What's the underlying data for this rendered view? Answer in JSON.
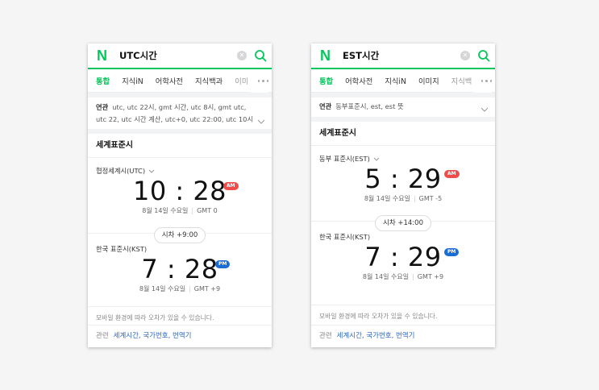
{
  "left": {
    "query": "UTC시간",
    "tabs": [
      "통합",
      "지식iN",
      "어학사전",
      "지식백과",
      "이미"
    ],
    "related_label": "연관",
    "related_text": "utc, utc 22시, gmt 시간, utc 8시, gmt utc, utc 22, utc 시간 계산, utc+0, utc 22:00, utc 10시",
    "section_title": "세계표준시",
    "zone1": "협정세계시(UTC)",
    "time1": "10 : 28",
    "ampm1": "AM",
    "date1": "8월 14일 수요일",
    "gmt1": "GMT 0",
    "diff": "시차 +9:00",
    "zone2": "한국 표준시(KST)",
    "time2": "7 : 28",
    "ampm2": "PM",
    "date2": "8월 14일 수요일",
    "gmt2": "GMT +9",
    "notice": "모바일 환경에 따라 오차가 있을 수 있습니다.",
    "footer_label": "관련",
    "footer_links": "세계시간, 국가번호, 번역기"
  },
  "right": {
    "query": "EST시간",
    "tabs": [
      "통합",
      "어학사전",
      "지식iN",
      "이미지",
      "지식백"
    ],
    "related_label": "연관",
    "related_text": "동부표준시, est, est 뜻",
    "section_title": "세계표준시",
    "zone1": "동부 표준시(EST)",
    "time1": "5 : 29",
    "ampm1": "AM",
    "date1": "8월 14일 수요일",
    "gmt1": "GMT -5",
    "diff": "시차 +14:00",
    "zone2": "한국 표준시(KST)",
    "time2": "7 : 29",
    "ampm2": "PM",
    "date2": "8월 14일 수요일",
    "gmt2": "GMT +9",
    "notice": "모바일 환경에 따라 오차가 있을 수 있습니다.",
    "footer_label": "관련",
    "footer_links": "세계시간, 국가번호, 번역기"
  },
  "icons": {
    "logo": "naver-logo-icon",
    "clear": "clear-icon",
    "search": "search-icon",
    "more": "more-dots-icon",
    "expand": "chevron-down-icon"
  },
  "colors": {
    "brand": "#03c75a",
    "am": "#f04c4c",
    "pm": "#1a6dd4",
    "link": "#2b66c4"
  },
  "logo_letter": "N"
}
